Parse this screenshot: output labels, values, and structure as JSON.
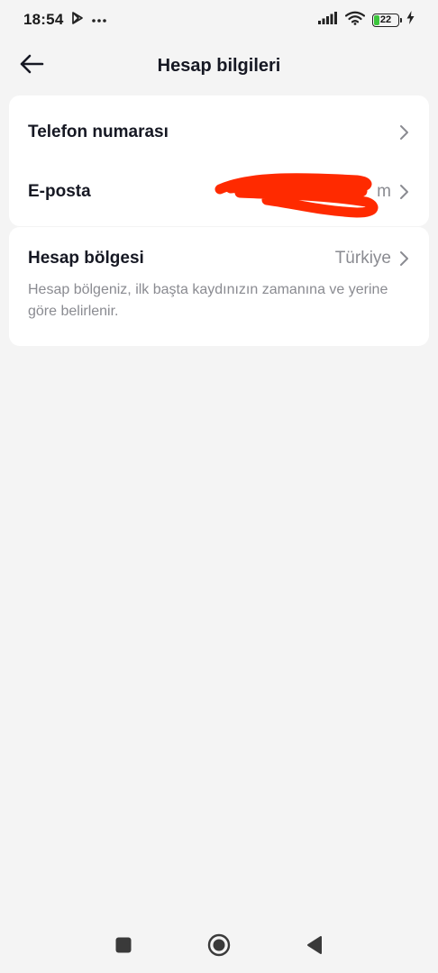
{
  "status_bar": {
    "time": "18:54",
    "battery_level": "22",
    "battery_fraction": 0.22,
    "icons": [
      "play-store-icon",
      "more-dots-icon",
      "signal-icon",
      "wifi-icon",
      "battery-icon",
      "charging-icon"
    ]
  },
  "header": {
    "title": "Hesap bilgileri",
    "back_icon": "arrow-left-icon"
  },
  "account_card": {
    "rows": [
      {
        "label": "Telefon numarası",
        "value": ""
      },
      {
        "label": "E-posta",
        "value": "m"
      }
    ]
  },
  "region_card": {
    "label": "Hesap bölgesi",
    "value": "Türkiye",
    "description": "Hesap bölgeniz, ilk başta kaydınızın zamanına ve yerine göre belirlenir."
  },
  "colors": {
    "background": "#f4f4f4",
    "card": "#ffffff",
    "text_primary": "#161823",
    "text_secondary": "#8a8b91",
    "redaction": "#ff2a00",
    "battery_green": "#3cc63c"
  },
  "nav_bar": {
    "icons": [
      "recent-apps-square-icon",
      "home-circle-icon",
      "back-triangle-icon"
    ]
  }
}
